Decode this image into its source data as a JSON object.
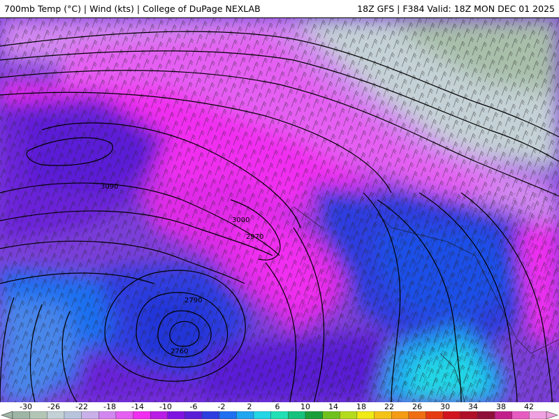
{
  "header": {
    "left_title": "700mb Temp (°C) | Wind (kts) | College of DuPage NEXLAB",
    "right_title": "18Z GFS | F384 Valid: 18Z MON DEC 01 2025"
  },
  "map": {
    "contour_labels": [
      {
        "text": "3090",
        "name": "contour-label-3090"
      },
      {
        "text": "3000",
        "name": "contour-label-3000"
      },
      {
        "text": "2970",
        "name": "contour-label-2970"
      },
      {
        "text": "2790",
        "name": "contour-label-2790"
      },
      {
        "text": "2760",
        "name": "contour-label-2760"
      }
    ]
  },
  "legend": {
    "tick_labels": [
      "-30",
      "-26",
      "-22",
      "-18",
      "-14",
      "-10",
      "-6",
      "-2",
      "2",
      "6",
      "10",
      "14",
      "18",
      "22",
      "26",
      "30",
      "34",
      "38",
      "42"
    ],
    "colors": [
      "#9fb5a6",
      "#b3c6b6",
      "#c4d1d6",
      "#b7c4dc",
      "#c9b0e8",
      "#d287f0",
      "#e45ff2",
      "#f02ef0",
      "#b91ee6",
      "#7f14e0",
      "#5a1fd6",
      "#2e3de0",
      "#1f6ff0",
      "#1fa6f0",
      "#22d6e6",
      "#22e0b5",
      "#16c27d",
      "#1a9e3a",
      "#6fc21e",
      "#b5db1e",
      "#f0ea16",
      "#f5c218",
      "#f59c14",
      "#f06e12",
      "#e63a12",
      "#d2141e",
      "#b00f2a",
      "#8e0f3a",
      "#c21f8a",
      "#e65bc2",
      "#f0a0e0"
    ]
  }
}
